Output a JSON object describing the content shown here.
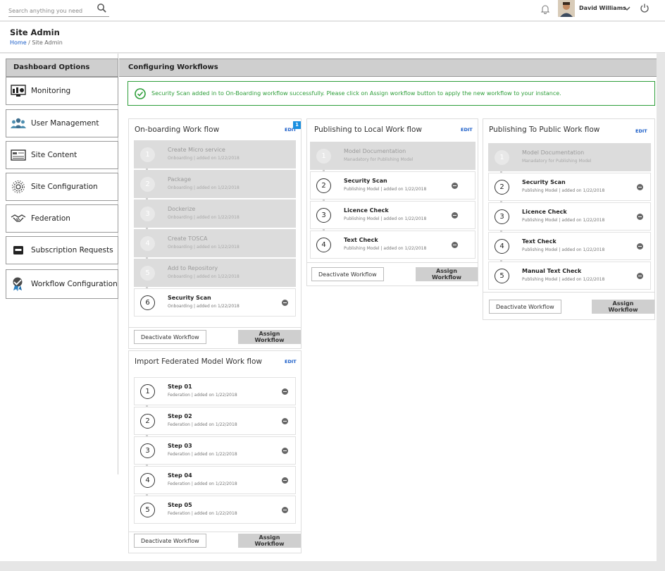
{
  "topbar": {
    "search_placeholder": "Search anything you need",
    "user_name": "David Williams"
  },
  "header": {
    "title": "Site Admin",
    "breadcrumb_home": "Home",
    "breadcrumb_sep": " / ",
    "breadcrumb_current": "Site Admin"
  },
  "sidebar": {
    "heading": "Dashboard Options",
    "items": [
      {
        "label": "Monitoring",
        "icon": "monitor-icon"
      },
      {
        "label": "User Management",
        "icon": "users-icon"
      },
      {
        "label": "Site Content",
        "icon": "content-icon"
      },
      {
        "label": "Site Configuration",
        "icon": "gear-icon"
      },
      {
        "label": "Federation",
        "icon": "handshake-icon"
      },
      {
        "label": "Subscription Requests",
        "icon": "inbox-icon"
      },
      {
        "label": "Workflow Configuration",
        "icon": "workflow-icon"
      }
    ]
  },
  "main": {
    "heading": "Configuring Workflows",
    "alert": "Security Scan added in to On-Boarding workflow successfully. Please click on Assign workflow button to apply the new workflow to your instance."
  },
  "buttons": {
    "deactivate": "Deactivate Workflow",
    "assign": "Assign Workflow",
    "edit": "EDIT"
  },
  "workflows": [
    {
      "title": "On-boarding Work flow",
      "badge": "1",
      "steps": [
        {
          "n": "1",
          "name": "Create Micro service",
          "desc": "Onboarding  |  added on 1/22/2018"
        },
        {
          "n": "2",
          "name": "Package",
          "desc": "Onboarding  |  added on 1/22/2018"
        },
        {
          "n": "3",
          "name": "Dockerize",
          "desc": "Onboarding  |  added on 1/22/2018"
        },
        {
          "n": "4",
          "name": "Create TOSCA",
          "desc": "Onboarding  |  added on 1/22/2018"
        },
        {
          "n": "5",
          "name": "Add to Repository",
          "desc": "Onboarding  |  added on 1/22/2018"
        },
        {
          "n": "6",
          "name": "Security Scan",
          "desc": "Onboarding  |  added on 1/22/2018"
        }
      ]
    },
    {
      "title": "Publishing to Local Work flow",
      "steps": [
        {
          "n": "1",
          "name": "Model Documentation",
          "desc": "Manadatory for Publishing Model"
        },
        {
          "n": "2",
          "name": "Security Scan",
          "desc": "Publishing Model  |  added on 1/22/2018"
        },
        {
          "n": "3",
          "name": "Licence Check",
          "desc": "Publishing Model  |  added on 1/22/2018"
        },
        {
          "n": "4",
          "name": "Text Check",
          "desc": "Publishing Model  |  added on 1/22/2018"
        }
      ]
    },
    {
      "title": "Publishing To Public Work flow",
      "steps": [
        {
          "n": "1",
          "name": "Model Documentation",
          "desc": "Manadatory for Publishing Model"
        },
        {
          "n": "2",
          "name": "Security Scan",
          "desc": "Publishing Model  |  added on 1/22/2018"
        },
        {
          "n": "3",
          "name": "Licence Check",
          "desc": "Publishing Model  |  added on 1/22/2018"
        },
        {
          "n": "4",
          "name": "Text Check",
          "desc": "Publishing Model  |  added on 1/22/2018"
        },
        {
          "n": "5",
          "name": "Manual Text Check",
          "desc": "Publishing Model  |  added on 1/22/2018"
        }
      ]
    },
    {
      "title": "Import Federated Model Work flow",
      "steps": [
        {
          "n": "1",
          "name": "Step 01",
          "desc": "Federation  |  added on 1/22/2018"
        },
        {
          "n": "2",
          "name": "Step 02",
          "desc": "Federation  |  added on 1/22/2018"
        },
        {
          "n": "3",
          "name": "Step 03",
          "desc": "Federation  |  added on 1/22/2018"
        },
        {
          "n": "4",
          "name": "Step 04",
          "desc": "Federation  |  added on 1/22/2018"
        },
        {
          "n": "5",
          "name": "Step 05",
          "desc": "Federation  |  added on 1/22/2018"
        }
      ]
    }
  ]
}
